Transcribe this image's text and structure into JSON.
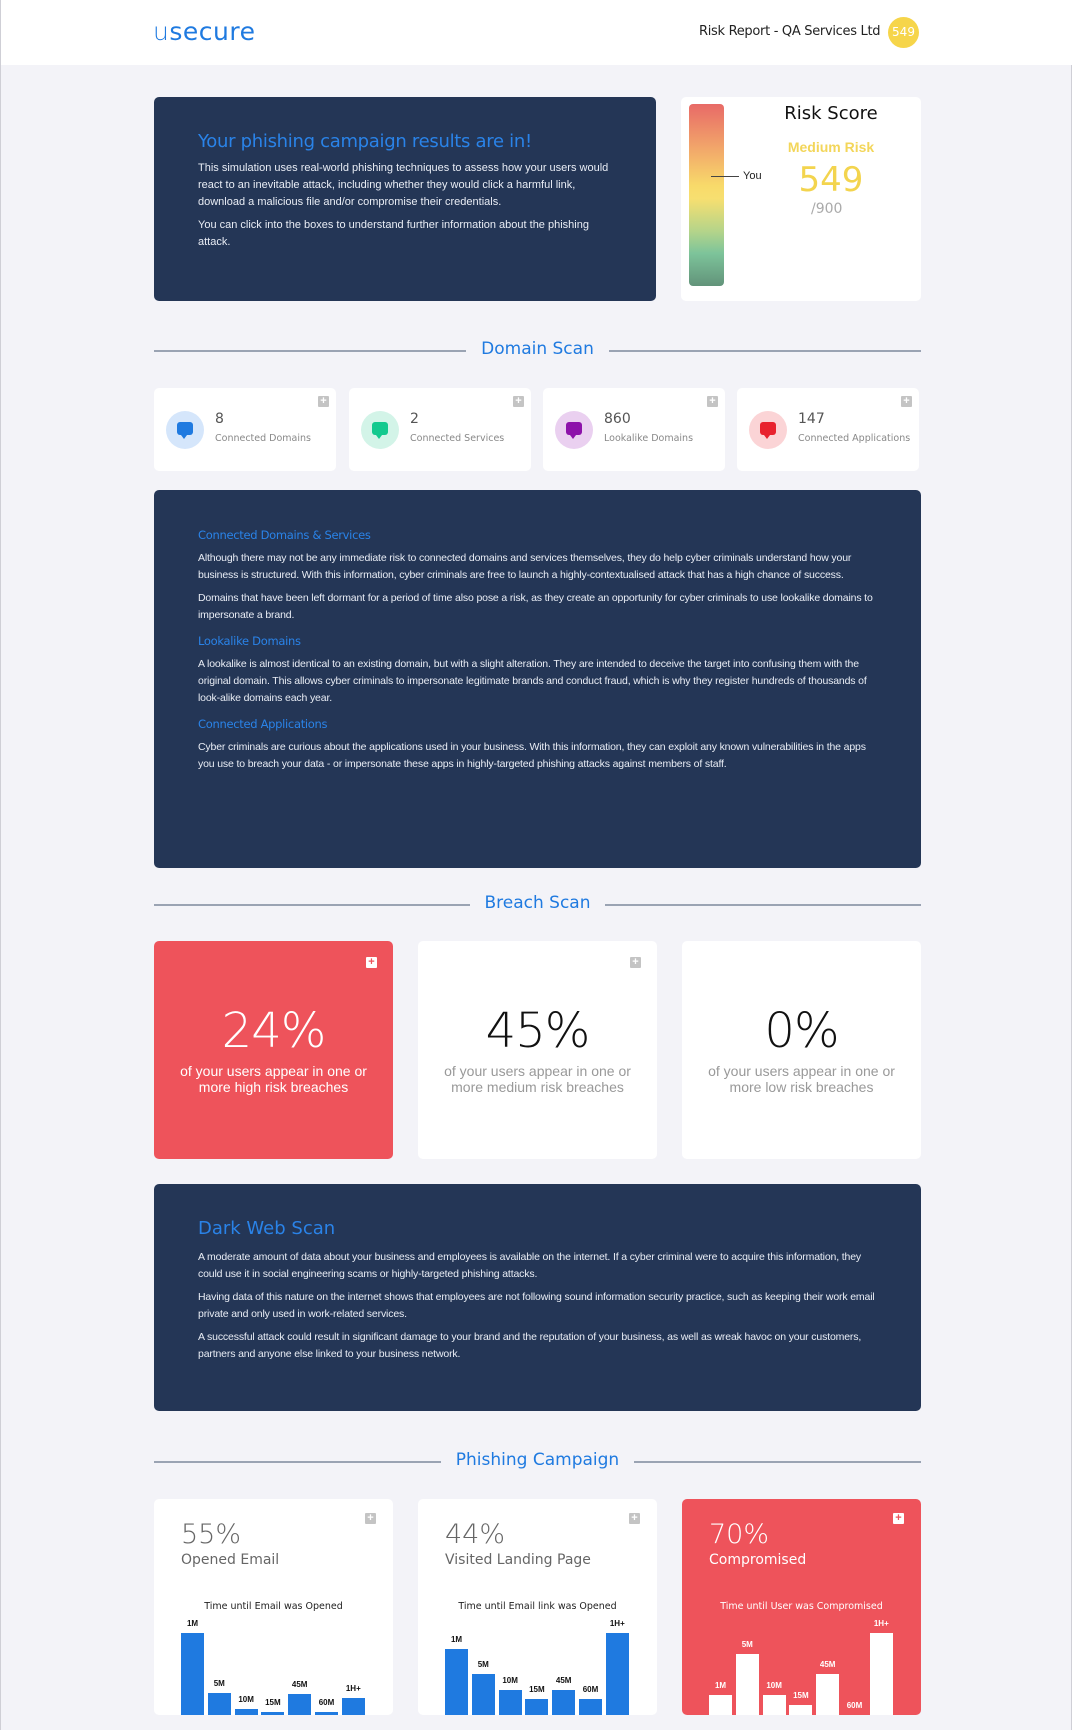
{
  "header": {
    "logo_u": "u",
    "logo_rest": "secure",
    "report_title": "Risk Report - QA Services Ltd",
    "score_badge": "549"
  },
  "intro": {
    "title": "Your phishing campaign results are in!",
    "paragraphs": [
      "This simulation uses real-world phishing techniques to assess how your users would react to an inevitable attack, including whether they would click a harmful link, download a malicious file and/or compromise their credentials.",
      "You can click into the boxes to understand further information about the phishing attack."
    ]
  },
  "risk_score": {
    "title": "Risk Score",
    "level": "Medium Risk",
    "score": "549",
    "max": "/900",
    "marker_label": "You",
    "level_color": "#f3d65a"
  },
  "domain_scan": {
    "section_title": "Domain Scan",
    "cards": [
      {
        "value": "8",
        "label": "Connected Domains",
        "icon": "chat-bubble-icon",
        "color": "#1f7ae0",
        "bg": "#d5e6fb"
      },
      {
        "value": "2",
        "label": "Connected Services",
        "icon": "chat-bubble-icon",
        "color": "#13c98e",
        "bg": "#d3f4e8"
      },
      {
        "value": "860",
        "label": "Lookalike Domains",
        "icon": "chat-bubble-icon",
        "color": "#8d12aa",
        "bg": "#ead0f0"
      },
      {
        "value": "147",
        "label": "Connected Applications",
        "icon": "chat-bubble-icon",
        "color": "#e8222e",
        "bg": "#fbd4d6"
      }
    ],
    "info": [
      {
        "heading": "Connected Domains & Services",
        "paragraphs": [
          "Although there may not be any immediate risk to connected domains and services themselves, they do help cyber criminals understand how your business is structured. With this information, cyber criminals are free to launch a highly-contextualised attack that has a high chance of success.",
          "Domains that have been left dormant for a period of time also pose a risk, as they create an opportunity for cyber criminals to use lookalike domains to impersonate a brand."
        ]
      },
      {
        "heading": "Lookalike Domains",
        "paragraphs": [
          "A lookalike is almost identical to an existing domain, but with a slight alteration. They are intended to deceive the target into confusing them with the original domain. This allows cyber criminals to impersonate legitimate brands and conduct fraud, which is why they register hundreds of thousands of look-alike domains each year."
        ]
      },
      {
        "heading": "Connected Applications",
        "paragraphs": [
          "Cyber criminals are curious about the applications used in your business. With this information, they can exploit any known vulnerabilities in the apps you use to breach your data - or impersonate these apps in highly-targeted phishing attacks against members of staff."
        ]
      }
    ]
  },
  "breach_scan": {
    "section_title": "Breach Scan",
    "cards": [
      {
        "pct": "24%",
        "desc": "of your users appear in one or more high risk breaches",
        "style": "red"
      },
      {
        "pct": "45%",
        "desc": "of your users appear in one or more medium risk breaches",
        "style": "white"
      },
      {
        "pct": "0%",
        "desc": "of your users appear in one or more low risk breaches",
        "style": "white"
      }
    ]
  },
  "dark_web": {
    "title": "Dark Web Scan",
    "paragraphs": [
      "A moderate amount of data about your business and employees is available on the internet. If a cyber criminal were to acquire this information, they could use it in social engineering scams or highly-targeted phishing attacks.",
      "Having data of this nature on the internet shows that employees are not following sound information security practice, such as keeping their work email private and only used in work-related services.",
      "A successful attack could result in significant damage to your brand and the reputation of your business, as well as wreak havoc on your customers, partners and anyone else linked to your business network."
    ]
  },
  "phishing": {
    "section_title": "Phishing Campaign",
    "cards": [
      {
        "pct": "55%",
        "label": "Opened Email",
        "style": "white"
      },
      {
        "pct": "44%",
        "label": "Visited Landing Page",
        "style": "white"
      },
      {
        "pct": "70%",
        "label": "Compromised",
        "style": "red"
      }
    ]
  },
  "chart_data": [
    {
      "type": "bar",
      "title": "Time until Email was Opened",
      "categories": [
        "1M",
        "5M",
        "10M",
        "15M",
        "45M",
        "60M",
        "1H+"
      ],
      "values": [
        100,
        27,
        7,
        4,
        26,
        4,
        21
      ],
      "bar_color": "#1f7ae0"
    },
    {
      "type": "bar",
      "title": "Time until Email link was Opened",
      "categories": [
        "1M",
        "5M",
        "10M",
        "15M",
        "45M",
        "60M",
        "1H+"
      ],
      "values": [
        80,
        50,
        30,
        20,
        30,
        20,
        100
      ],
      "bar_color": "#1f7ae0"
    },
    {
      "type": "bar",
      "title": "Time until User was Compromised",
      "categories": [
        "1M",
        "5M",
        "10M",
        "15M",
        "45M",
        "60M",
        "1H+"
      ],
      "values": [
        25,
        75,
        25,
        12,
        50,
        0,
        100
      ],
      "bar_color": "#ffffff"
    }
  ]
}
